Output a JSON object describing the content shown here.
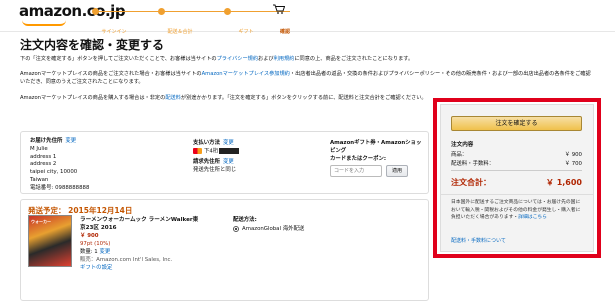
{
  "header": {
    "logo_text": "amazon.co.jp",
    "steps": [
      {
        "label": "サインイン"
      },
      {
        "label": "配送＆合計"
      },
      {
        "label": "ギフト"
      },
      {
        "label": "確認"
      }
    ]
  },
  "page": {
    "title": "注文内容を確認・変更する",
    "intro_a": "下の「注文を確定する」ボタンを押してご注文いただくことで、お客様は当サイトの",
    "privacy_link": "プライバシー規約",
    "intro_b": "および",
    "terms_link": "利用規約",
    "intro_c": "に同意の上、商品をご注文されたことになります。",
    "mp_text_a": "Amazonマーケットプレイスの商品をご注文された場合・お客様は当サイトの",
    "mp_link": "Amazonマーケットプレイス参加規約",
    "mp_text_b": "・出店者出品者の返品・交換の条件およびプライバシーポリシー・その他の販売条件・および一部の出店出品者の各条件をご確認いただき、同意のうえご注文されたことになります。",
    "mp2_text_a": "Amazonマーケットプレイスの商品を購入する場合は・非定の",
    "mp2_link": "配送料",
    "mp2_text_b": "が別途かかります。「注文を確定する」ボタンをクリックする前に、配送料と注文合計をご確認ください。"
  },
  "shipping_address": {
    "heading": "お届け先住所",
    "change": "変更",
    "lines": [
      "M Julie",
      "address 1",
      "address 2",
      "taipei city, 10000",
      "Taiwan",
      "電話番号: 0988888888"
    ]
  },
  "payment": {
    "heading": "支払い方法",
    "change": "変更",
    "card_text": "下4桁",
    "billing_heading": "請求先住所",
    "billing_change": "変更",
    "billing_value": "発送先住所と同じ"
  },
  "gift_card": {
    "heading_1": "Amazonギフト券・Amazonショッピング",
    "heading_2": "カードまたはクーポン:",
    "placeholder": "コードを入力",
    "apply": "適用"
  },
  "shipment": {
    "date_label": "発送予定： 2015年12月14日",
    "book_badge": "ウォーカー",
    "item_title_1": "ラーメンウォーカームック ラーメンWalker東",
    "item_title_2": "京23区 2016",
    "price": "￥ 900",
    "points": "97pt (10%)",
    "qty_label": "数量: 1",
    "qty_change": "変更",
    "seller": "販売：Amazon.com Int'l Sales, Inc.",
    "gift_option": "ギフトの設定",
    "method_heading": "配送方法:",
    "method_value": "AmazonGlobal 海外配送"
  },
  "summary": {
    "place_order": "注文を確定する",
    "heading": "注文内容",
    "items_label": "商品：",
    "items_value": "￥ 900",
    "shipping_label": "配送料・手数料：",
    "shipping_value": "￥ 700",
    "total_label": "注文合計：",
    "total_value": "￥ 1,600",
    "note_a": "日本国外に配送するご注文商品については・お届け先の国において輸入税・関税およびその他の料金が発生し・購入者に負担いただく場合があります・",
    "note_link": "詳細はこちら",
    "fees_link": "配送料・手数料について"
  }
}
